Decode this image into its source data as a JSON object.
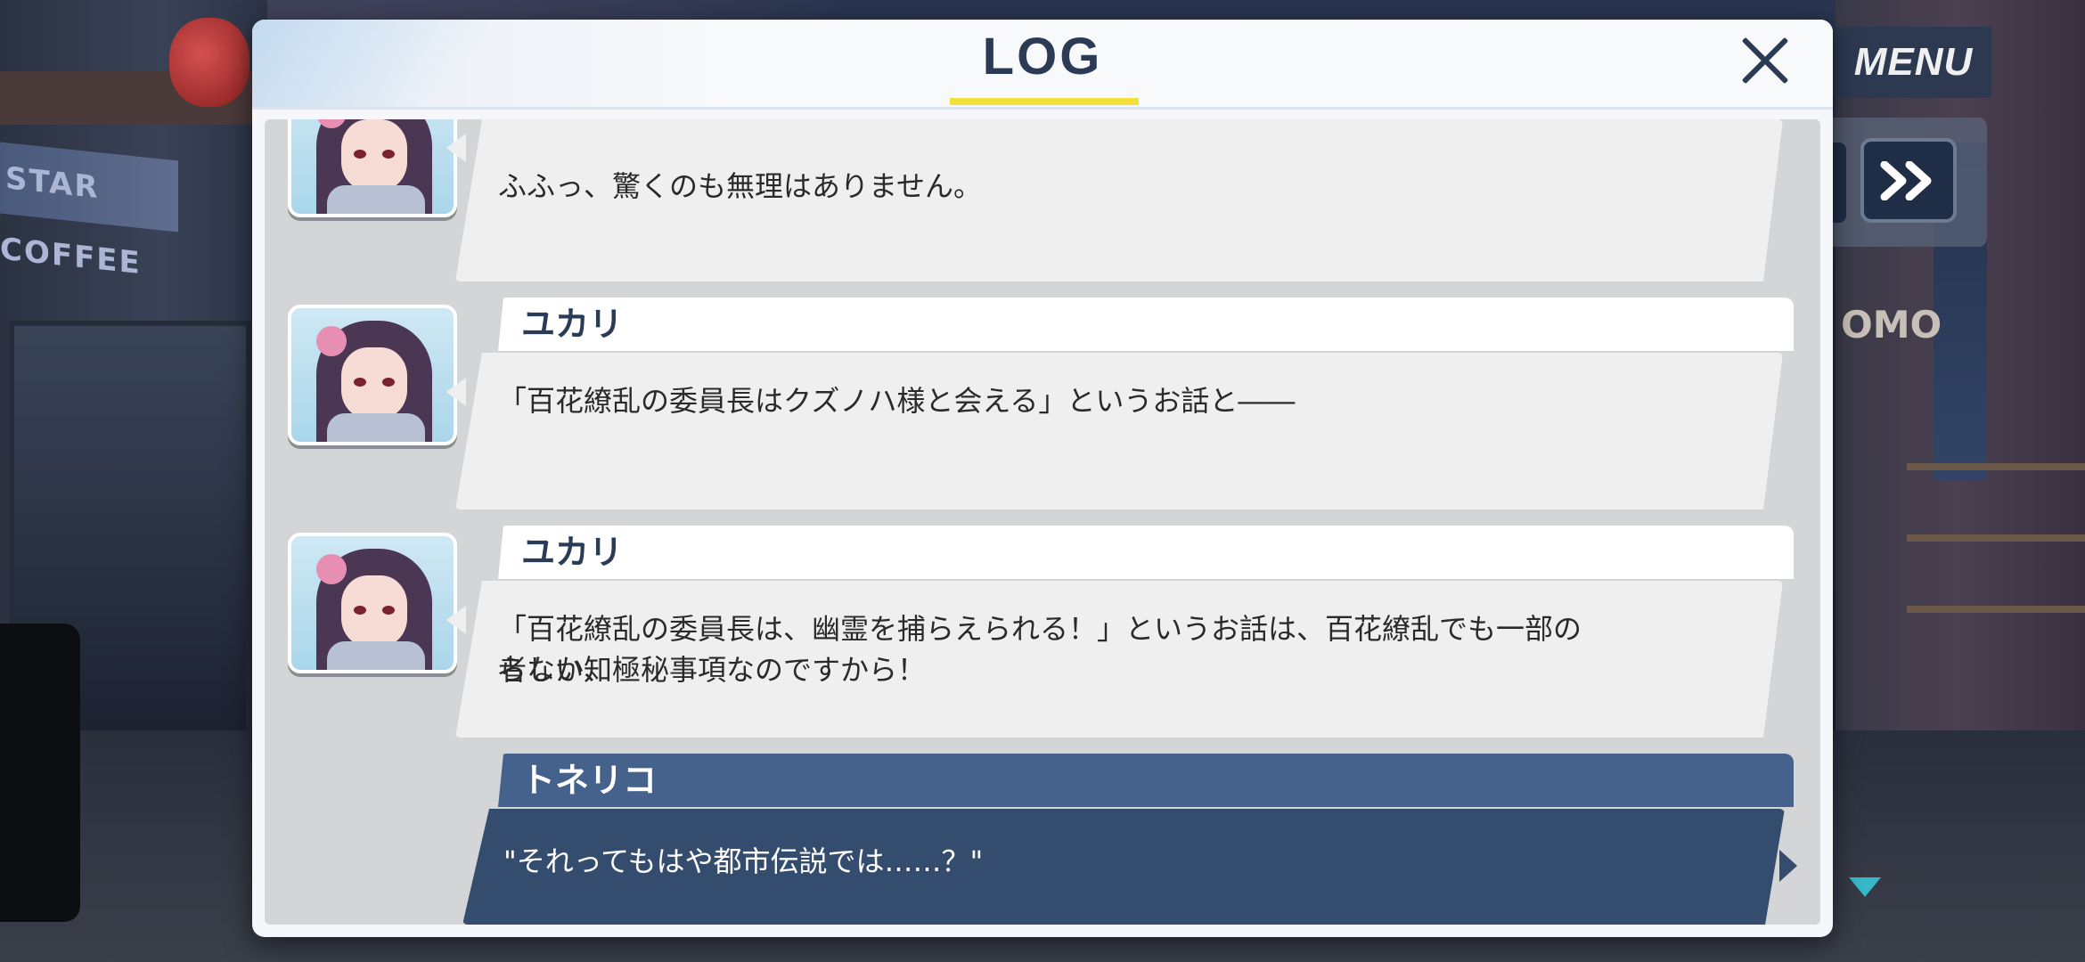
{
  "hud": {
    "menu_label": "MENU",
    "skip_icon": "fast-forward-icon",
    "next_icon": "down-triangle-icon"
  },
  "background": {
    "shop_sign": "STAR COFFEE",
    "shop_sign_right": "OMO"
  },
  "log": {
    "title": "LOG",
    "close_icon": "close-icon",
    "accent_color": "#f2e13a",
    "entries": [
      {
        "speaker": "",
        "text_lines": [
          "ふふっ、驚くのも無理はありません。"
        ]
      },
      {
        "speaker": "ユカリ",
        "text_lines": [
          "「百花繚乱の委員長はクズノハ様と会える」というお話と――"
        ]
      },
      {
        "speaker": "ユカリ",
        "text_lines": [
          "「百花繚乱の委員長は、幽霊を捕らえられる！」というお話は、百花繚乱でも一部の者しか知",
          "らない、極秘事項なのですから！"
        ]
      },
      {
        "speaker": "トネリコ",
        "text_lines": [
          "\"それってもはや都市伝説では……？\""
        ]
      }
    ]
  }
}
